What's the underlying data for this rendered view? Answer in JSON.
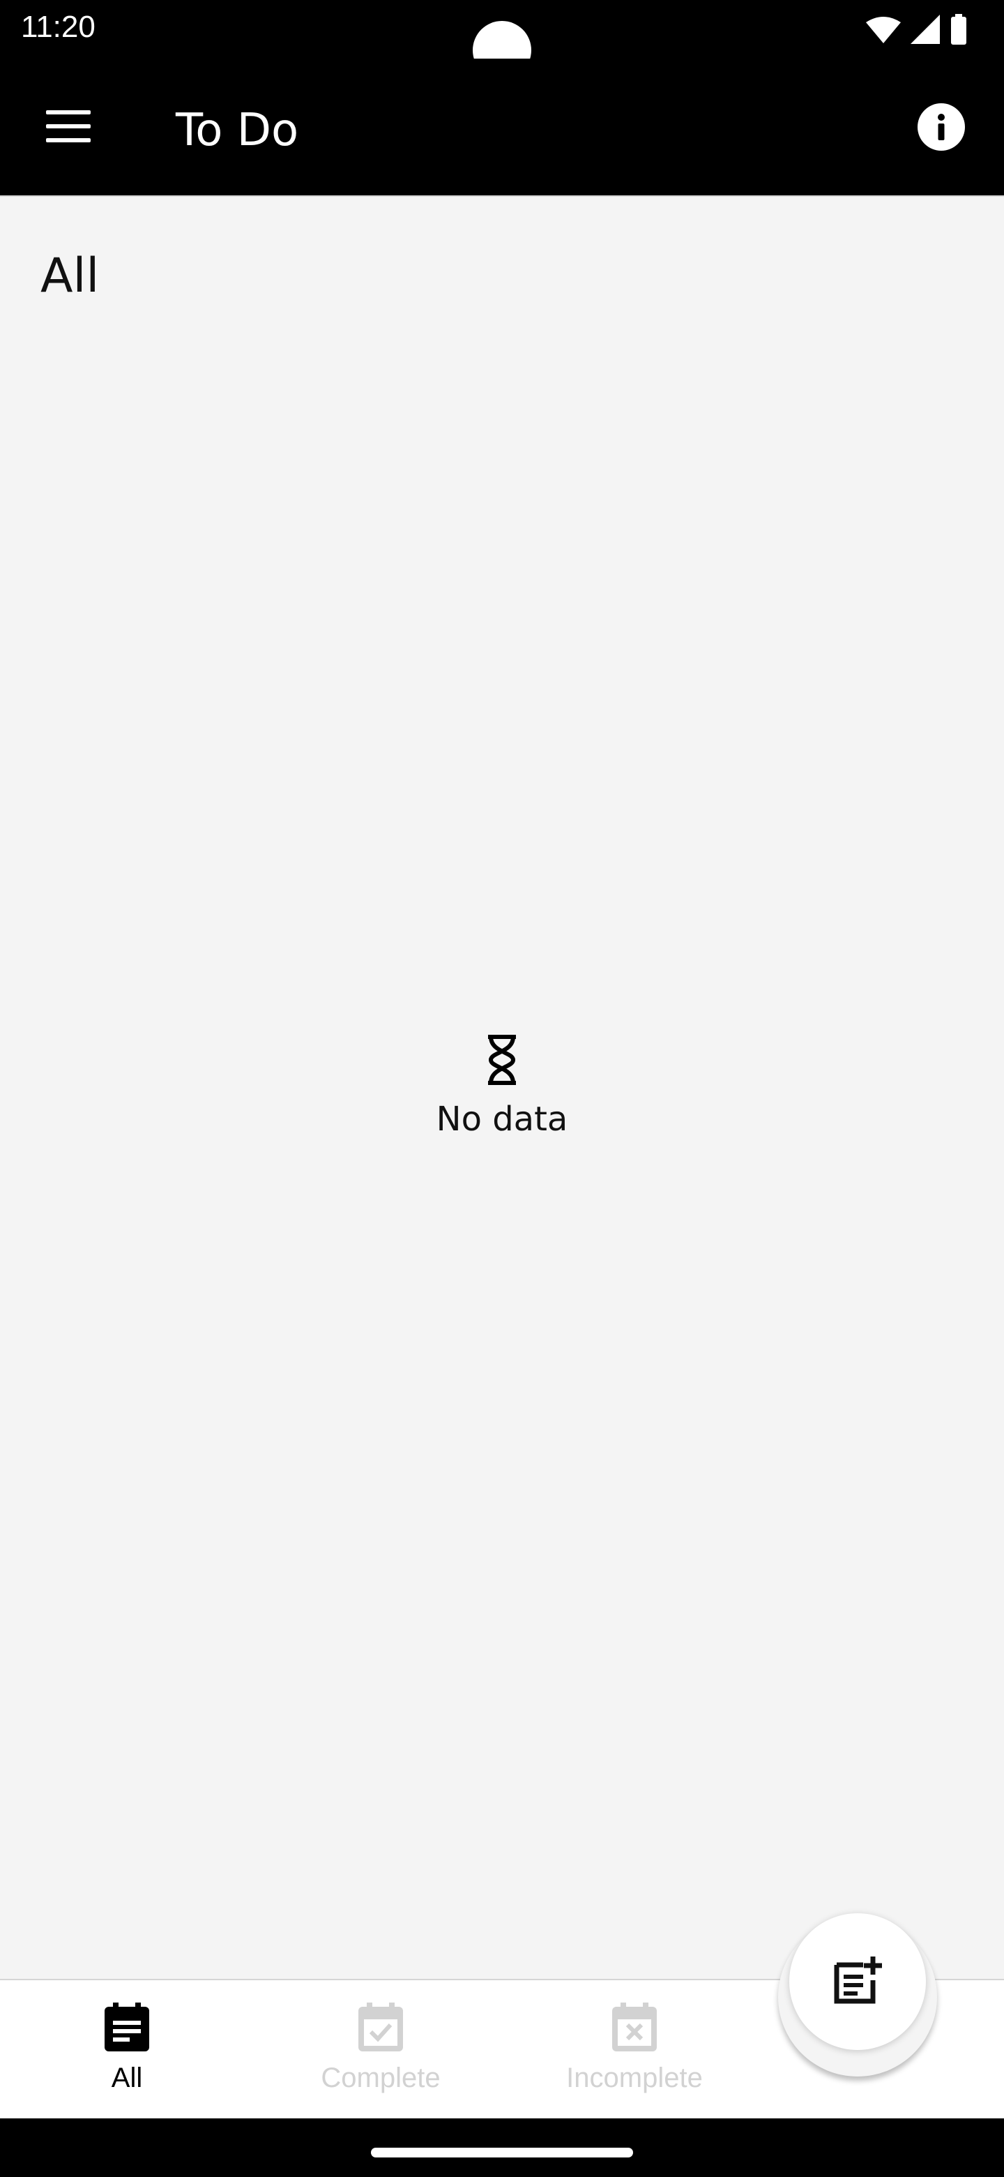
{
  "status_bar": {
    "time": "11:20",
    "icons": [
      "wifi-icon",
      "signal-icon",
      "battery-icon"
    ]
  },
  "app_bar": {
    "title": "To Do",
    "menu_icon": "menu-icon",
    "info_icon": "info-icon"
  },
  "main": {
    "section_title": "All",
    "empty_state": {
      "icon": "hourglass-icon",
      "text": "No data"
    }
  },
  "bottom_nav": {
    "items": [
      {
        "label": "All",
        "icon": "calendar-list-icon",
        "selected": true
      },
      {
        "label": "Complete",
        "icon": "calendar-check-icon",
        "selected": false
      },
      {
        "label": "Incomplete",
        "icon": "calendar-x-icon",
        "selected": false
      }
    ],
    "fab_icon": "add-note-icon"
  },
  "colors": {
    "app_bar": "#000000",
    "background": "#f4f4f4",
    "nav_active": "#000000",
    "nav_inactive": "#d2d2d2"
  }
}
